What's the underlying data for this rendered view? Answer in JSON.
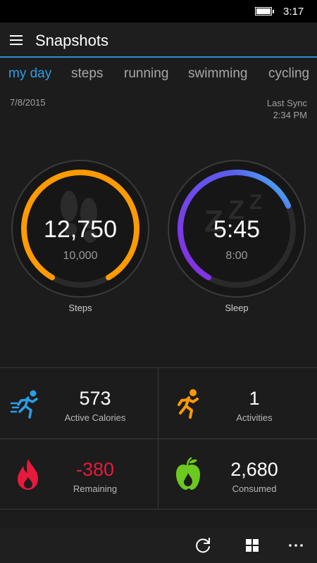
{
  "status_bar": {
    "time": "3:17",
    "battery_icon": "battery-full-icon"
  },
  "app_bar": {
    "title": "Snapshots",
    "menu_icon": "hamburger-menu-icon"
  },
  "tabs": [
    {
      "label": "my day",
      "active": true
    },
    {
      "label": "steps",
      "active": false
    },
    {
      "label": "running",
      "active": false
    },
    {
      "label": "swimming",
      "active": false
    },
    {
      "label": "cycling",
      "active": false
    }
  ],
  "date": "7/8/2015",
  "sync": {
    "label": "Last Sync",
    "time": "2:34 PM"
  },
  "gauges": {
    "steps": {
      "value": "12,750",
      "goal": "10,000",
      "label": "Steps",
      "progress": 1.0,
      "color": "#ff9a00",
      "icon": "footprints-icon"
    },
    "sleep": {
      "value": "5:45",
      "goal": "8:00",
      "label": "Sleep",
      "progress": 0.72,
      "color_start": "#8a2be2",
      "color_end": "#3fd0f0",
      "icon": "zzz-sleep-icon"
    }
  },
  "tiles": {
    "active_calories": {
      "value": "573",
      "label": "Active Calories",
      "icon": "running-person-icon",
      "color": "#2a9ee6"
    },
    "activities": {
      "value": "1",
      "label": "Activities",
      "icon": "runner-icon",
      "color": "#ff9a00"
    },
    "remaining": {
      "value": "-380",
      "label": "Remaining",
      "icon": "flame-icon",
      "color": "#e8193c"
    },
    "consumed": {
      "value": "2,680",
      "label": "Consumed",
      "icon": "apple-icon",
      "color": "#6cc91f"
    }
  },
  "bottom_bar": {
    "sync_icon": "refresh-icon",
    "tiles_icon": "grid-icon",
    "more_icon": "more-icon"
  }
}
